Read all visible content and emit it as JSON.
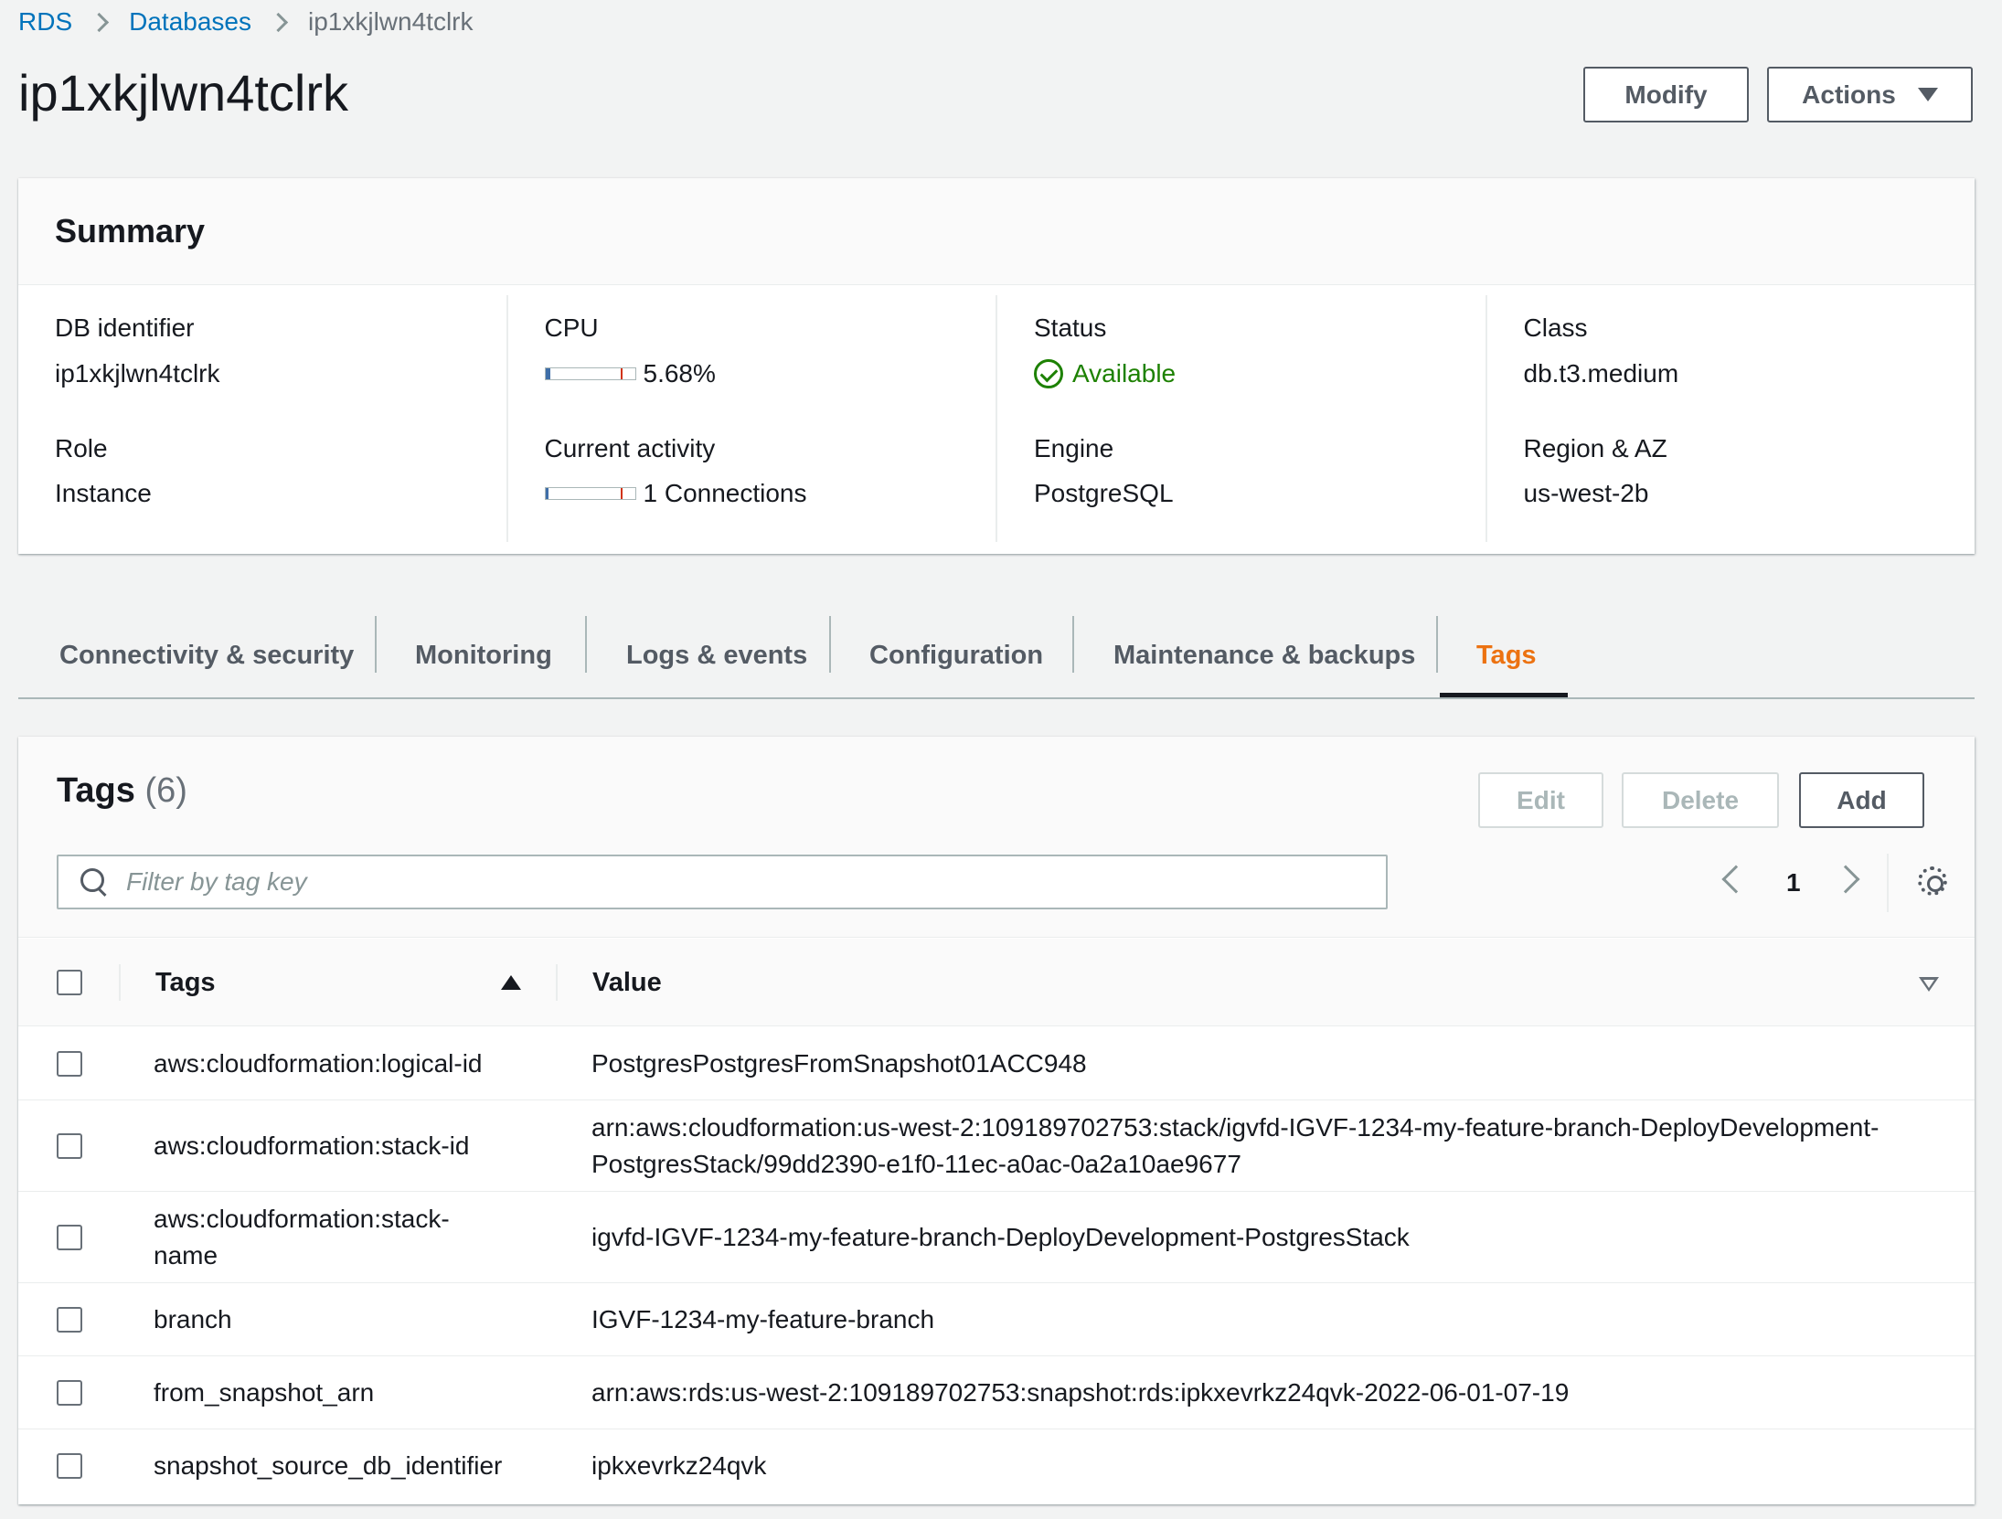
{
  "breadcrumb": {
    "items": [
      "RDS",
      "Databases",
      "ip1xkjlwn4tclrk"
    ]
  },
  "page": {
    "title": "ip1xkjlwn4tclrk",
    "buttons": {
      "modify": "Modify",
      "actions": "Actions"
    }
  },
  "summary": {
    "title": "Summary",
    "db_identifier": {
      "label": "DB identifier",
      "value": "ip1xkjlwn4tclrk"
    },
    "role": {
      "label": "Role",
      "value": "Instance"
    },
    "cpu": {
      "label": "CPU",
      "value": "5.68%",
      "fill_fraction": 0.0568
    },
    "current_activity": {
      "label": "Current activity",
      "value": "1 Connections",
      "fill_fraction": 0.01
    },
    "status": {
      "label": "Status",
      "value": "Available",
      "color": "#1d8102",
      "icon": "check-circle-icon"
    },
    "engine": {
      "label": "Engine",
      "value": "PostgreSQL"
    },
    "class": {
      "label": "Class",
      "value": "db.t3.medium"
    },
    "region_az": {
      "label": "Region & AZ",
      "value": "us-west-2b"
    }
  },
  "tabs": {
    "items": [
      "Connectivity & security",
      "Monitoring",
      "Logs & events",
      "Configuration",
      "Maintenance & backups",
      "Tags"
    ],
    "active": "Tags",
    "active_color": "#ec7211"
  },
  "tags_panel": {
    "title": "Tags",
    "count": "(6)",
    "buttons": {
      "edit": "Edit",
      "delete": "Delete",
      "add": "Add"
    },
    "search": {
      "placeholder": "Filter by tag key",
      "value": ""
    },
    "pagination": {
      "current_page": "1"
    },
    "columns": {
      "key": "Tags",
      "value": "Value"
    },
    "rows": [
      {
        "key": "aws:cloudformation:logical-id",
        "value": "PostgresPostgresFromSnapshot01ACC948"
      },
      {
        "key": "aws:cloudformation:stack-id",
        "value": "arn:aws:cloudformation:us-west-2:109189702753:stack/igvfd-IGVF-1234-my-feature-branch-DeployDevelopment-PostgresStack/99dd2390-e1f0-11ec-a0ac-0a2a10ae9677"
      },
      {
        "key": "aws:cloudformation:stack-name",
        "value": "igvfd-IGVF-1234-my-feature-branch-DeployDevelopment-PostgresStack"
      },
      {
        "key": "branch",
        "value": "IGVF-1234-my-feature-branch"
      },
      {
        "key": "from_snapshot_arn",
        "value": "arn:aws:rds:us-west-2:109189702753:snapshot:rds:ipkxevrkz24qvk-2022-06-01-07-19"
      },
      {
        "key": "snapshot_source_db_identifier",
        "value": "ipkxevrkz24qvk"
      }
    ]
  }
}
